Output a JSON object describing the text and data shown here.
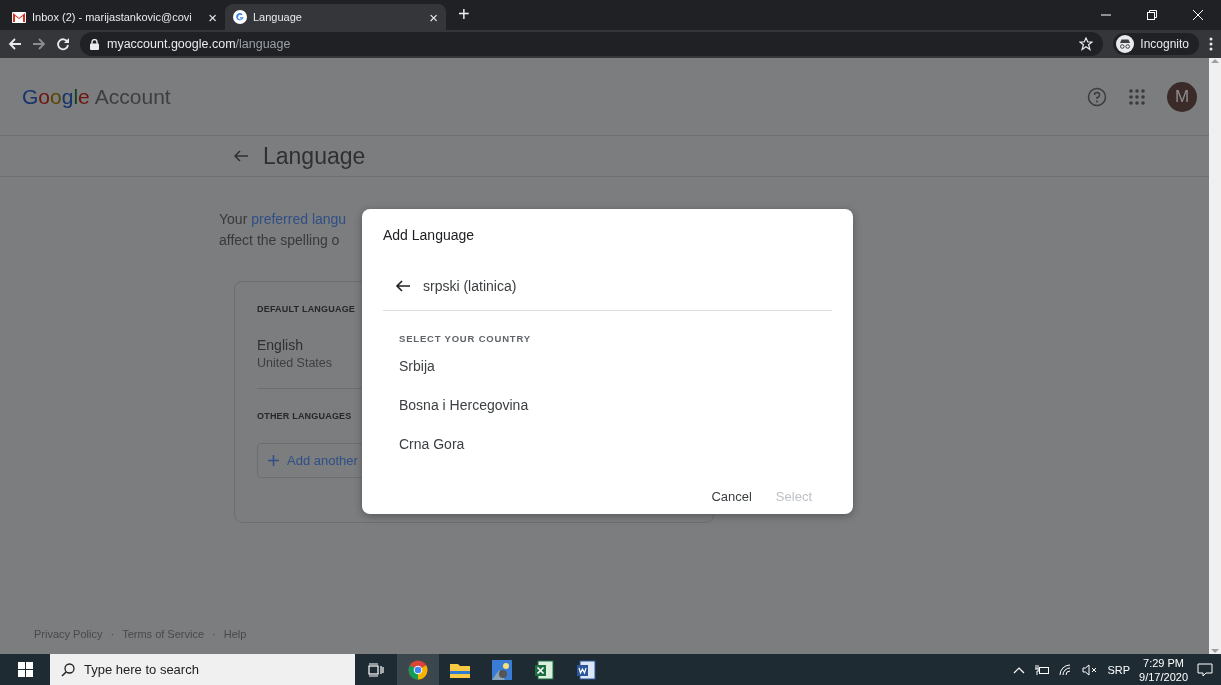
{
  "browser": {
    "tabs": [
      {
        "title": "Inbox (2) - marijastankovic@covi",
        "kind": "mail",
        "selected": false,
        "close": "×"
      },
      {
        "title": "Language",
        "kind": "google",
        "selected": true,
        "close": "×"
      }
    ],
    "new_tab": "+",
    "url_host": "myaccount.google.com",
    "url_path": "/language",
    "profile": "Incognito"
  },
  "header": {
    "logo_word": "Google",
    "logo_product": "Account",
    "avatar": "M"
  },
  "page": {
    "back_title": "Language",
    "intro_before": "Your",
    "intro_link": "preferred langu",
    "intro_line2": "affect the spelling o",
    "default_label": "DEFAULT LANGUAGE",
    "default_language": "English",
    "default_region": "United States",
    "other_label": "OTHER LANGUAGES",
    "add_button": "Add another"
  },
  "dialog": {
    "title": "Add Language",
    "language": "srpski (latinica)",
    "section_label": "SELECT YOUR COUNTRY",
    "countries": [
      {
        "name": "Srbija",
        "selected": false
      },
      {
        "name": "Bosna i Hercegovina",
        "selected": false
      },
      {
        "name": "Crna Gora",
        "selected": false
      }
    ],
    "cancel": "Cancel",
    "select": {
      "label": "Select",
      "disabled": true
    }
  },
  "footer": {
    "links": [
      "Privacy Policy",
      "Terms of Service",
      "Help"
    ],
    "separator": "·"
  },
  "taskbar": {
    "search_placeholder": "Type here to search",
    "apps": [
      {
        "kind": "taskview",
        "active": false
      },
      {
        "kind": "chrome",
        "active": true
      },
      {
        "kind": "folder",
        "active": false
      },
      {
        "kind": "photos",
        "active": false
      },
      {
        "kind": "excel",
        "active": false
      },
      {
        "kind": "word",
        "active": false
      }
    ],
    "language": "SRP",
    "time": "7:29 PM",
    "date": "9/17/2020"
  }
}
